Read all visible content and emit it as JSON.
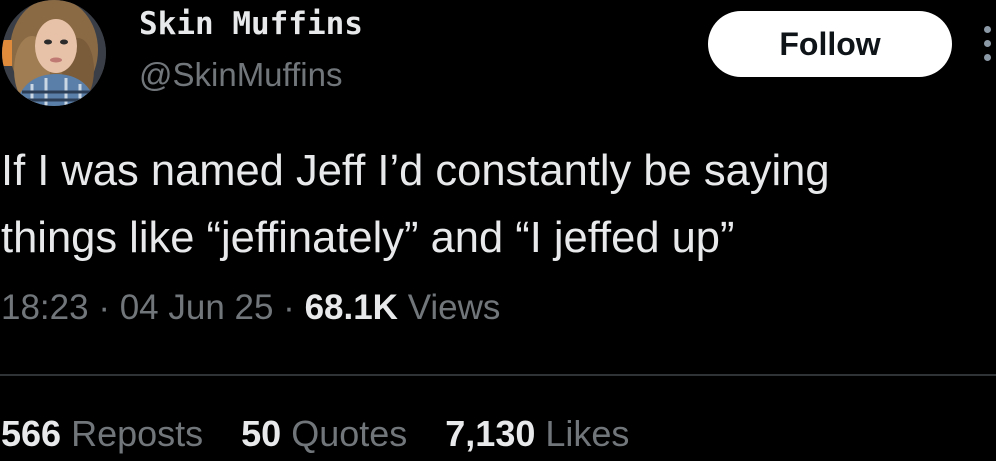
{
  "author": {
    "display_name": "Skin Muffins",
    "handle": "@SkinMuffins"
  },
  "follow_label": "Follow",
  "tweet": {
    "text": "If I was named Jeff I’d constantly be saying\nthings like “jeffinately” and “I jeffed up”"
  },
  "meta": {
    "time": "18:23",
    "separator": " · ",
    "date": "04 Jun 25",
    "views_count": "68.1K",
    "views_label": " Views"
  },
  "stats": {
    "reposts_count": "566",
    "reposts_label": " Reposts",
    "quotes_count": "50",
    "quotes_label": " Quotes",
    "likes_count": "7,130",
    "likes_label": " Likes"
  },
  "colors": {
    "background": "#000000",
    "primary_text": "#e7e9ea",
    "secondary_text": "#71767b",
    "follow_button_bg": "#ffffff",
    "divider": "#2f3336"
  },
  "icons": {
    "more": "more-vertical-icon"
  }
}
